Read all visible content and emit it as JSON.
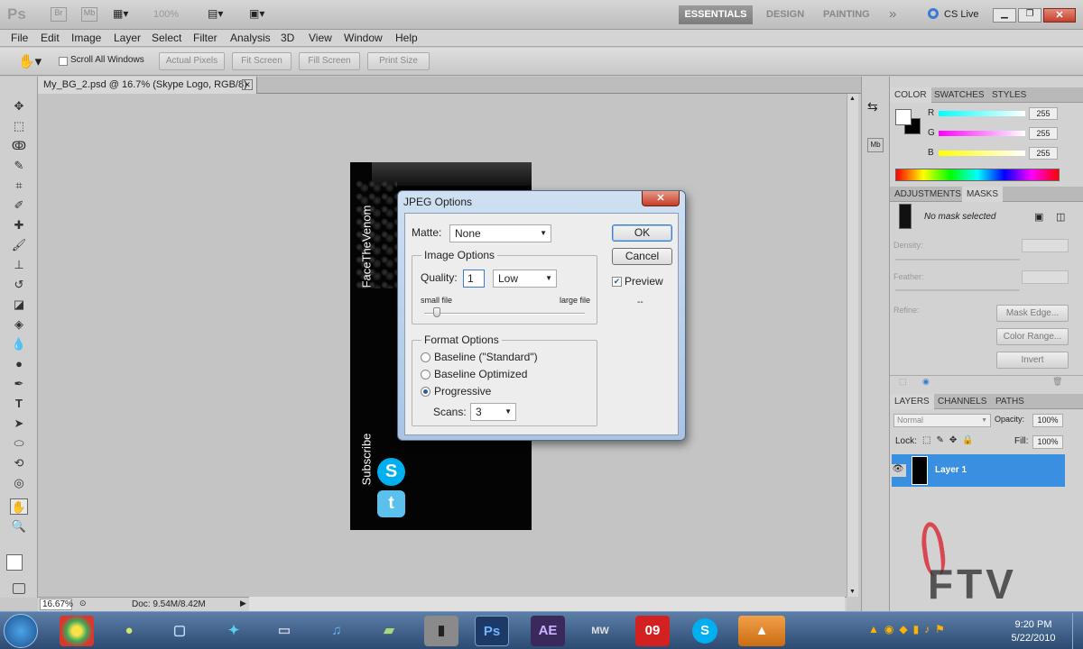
{
  "app": {
    "logo": "Ps",
    "zoom_select": "100%"
  },
  "workspaces": {
    "essentials": "ESSENTIALS",
    "design": "DESIGN",
    "painting": "PAINTING",
    "more": "»",
    "cslive": "CS Live"
  },
  "menu": [
    "File",
    "Edit",
    "Image",
    "Layer",
    "Select",
    "Filter",
    "Analysis",
    "3D",
    "View",
    "Window",
    "Help"
  ],
  "options_bar": {
    "scroll_all": "Scroll All Windows",
    "actual_pixels": "Actual Pixels",
    "fit_screen": "Fit Screen",
    "fill_screen": "Fill Screen",
    "print_size": "Print Size"
  },
  "document": {
    "tab_title": "My_BG_2.psd @ 16.7% (Skype Logo, RGB/8)",
    "vertical_text_top": "FaceTheVenom",
    "vertical_text_bottom": "Subscribe"
  },
  "status": {
    "zoom": "16.67%",
    "doc_size": "Doc: 9.54M/8.42M"
  },
  "dialog": {
    "title": "JPEG Options",
    "matte_label": "Matte:",
    "matte_value": "None",
    "image_options_label": "Image Options",
    "quality_label": "Quality:",
    "quality_value": "1",
    "quality_preset": "Low",
    "small_file": "small file",
    "large_file": "large file",
    "quality_slider_level": 0.08,
    "format_options_label": "Format Options",
    "format_baseline_standard": "Baseline (\"Standard\")",
    "format_baseline_optimized": "Baseline Optimized",
    "format_progressive": "Progressive",
    "selected_format": "Progressive",
    "scans_label": "Scans:",
    "scans_value": "3",
    "ok": "OK",
    "cancel": "Cancel",
    "preview": "Preview",
    "preview_checked": true,
    "file_size": "--"
  },
  "color_panel": {
    "tabs": [
      "COLOR",
      "SWATCHES",
      "STYLES"
    ],
    "r_label": "R",
    "g_label": "G",
    "b_label": "B",
    "r_value": "255",
    "g_value": "255",
    "b_value": "255"
  },
  "masks_panel": {
    "tabs": [
      "ADJUSTMENTS",
      "MASKS"
    ],
    "no_mask": "No mask selected",
    "density": "Density:",
    "feather": "Feather:",
    "refine": "Refine:",
    "mask_edge": "Mask Edge...",
    "color_range": "Color Range...",
    "invert": "Invert"
  },
  "layers_panel": {
    "tabs": [
      "LAYERS",
      "CHANNELS",
      "PATHS"
    ],
    "blend_mode": "Normal",
    "opacity_label": "Opacity:",
    "opacity_value": "100%",
    "lock_label": "Lock:",
    "fill_label": "Fill:",
    "fill_value": "100%",
    "layer_name": "Layer 1"
  },
  "watermark": "FTV",
  "taskbar": {
    "time": "9:20 PM",
    "date": "5/22/2010",
    "icons": [
      "AE",
      "09",
      "Ps"
    ]
  },
  "colors": {
    "accent_blue": "#3b8fe0",
    "skype": "#00aff0",
    "twitter": "#5bc0eb",
    "ftv_red": "#d8303a"
  }
}
